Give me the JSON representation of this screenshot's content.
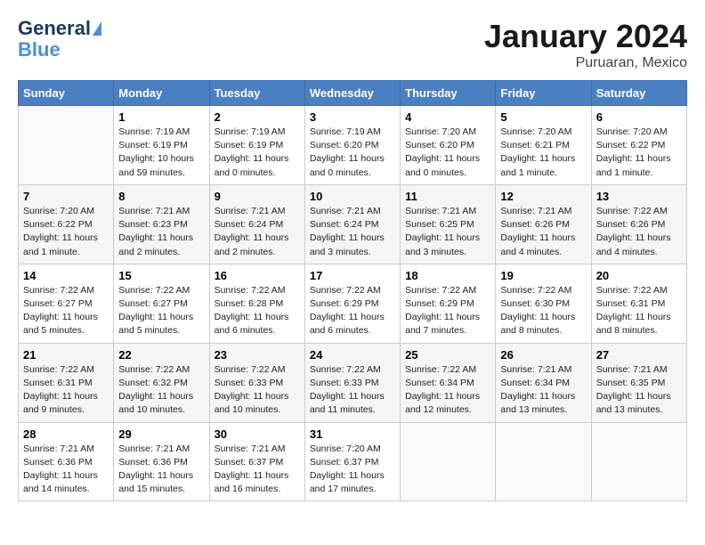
{
  "header": {
    "logo_line1": "General",
    "logo_line2": "Blue",
    "title": "January 2024",
    "subtitle": "Puruaran, Mexico"
  },
  "days_of_week": [
    "Sunday",
    "Monday",
    "Tuesday",
    "Wednesday",
    "Thursday",
    "Friday",
    "Saturday"
  ],
  "weeks": [
    [
      {
        "num": "",
        "info": ""
      },
      {
        "num": "1",
        "info": "Sunrise: 7:19 AM\nSunset: 6:19 PM\nDaylight: 10 hours\nand 59 minutes."
      },
      {
        "num": "2",
        "info": "Sunrise: 7:19 AM\nSunset: 6:19 PM\nDaylight: 11 hours\nand 0 minutes."
      },
      {
        "num": "3",
        "info": "Sunrise: 7:19 AM\nSunset: 6:20 PM\nDaylight: 11 hours\nand 0 minutes."
      },
      {
        "num": "4",
        "info": "Sunrise: 7:20 AM\nSunset: 6:20 PM\nDaylight: 11 hours\nand 0 minutes."
      },
      {
        "num": "5",
        "info": "Sunrise: 7:20 AM\nSunset: 6:21 PM\nDaylight: 11 hours\nand 1 minute."
      },
      {
        "num": "6",
        "info": "Sunrise: 7:20 AM\nSunset: 6:22 PM\nDaylight: 11 hours\nand 1 minute."
      }
    ],
    [
      {
        "num": "7",
        "info": "Sunrise: 7:20 AM\nSunset: 6:22 PM\nDaylight: 11 hours\nand 1 minute."
      },
      {
        "num": "8",
        "info": "Sunrise: 7:21 AM\nSunset: 6:23 PM\nDaylight: 11 hours\nand 2 minutes."
      },
      {
        "num": "9",
        "info": "Sunrise: 7:21 AM\nSunset: 6:24 PM\nDaylight: 11 hours\nand 2 minutes."
      },
      {
        "num": "10",
        "info": "Sunrise: 7:21 AM\nSunset: 6:24 PM\nDaylight: 11 hours\nand 3 minutes."
      },
      {
        "num": "11",
        "info": "Sunrise: 7:21 AM\nSunset: 6:25 PM\nDaylight: 11 hours\nand 3 minutes."
      },
      {
        "num": "12",
        "info": "Sunrise: 7:21 AM\nSunset: 6:26 PM\nDaylight: 11 hours\nand 4 minutes."
      },
      {
        "num": "13",
        "info": "Sunrise: 7:22 AM\nSunset: 6:26 PM\nDaylight: 11 hours\nand 4 minutes."
      }
    ],
    [
      {
        "num": "14",
        "info": "Sunrise: 7:22 AM\nSunset: 6:27 PM\nDaylight: 11 hours\nand 5 minutes."
      },
      {
        "num": "15",
        "info": "Sunrise: 7:22 AM\nSunset: 6:27 PM\nDaylight: 11 hours\nand 5 minutes."
      },
      {
        "num": "16",
        "info": "Sunrise: 7:22 AM\nSunset: 6:28 PM\nDaylight: 11 hours\nand 6 minutes."
      },
      {
        "num": "17",
        "info": "Sunrise: 7:22 AM\nSunset: 6:29 PM\nDaylight: 11 hours\nand 6 minutes."
      },
      {
        "num": "18",
        "info": "Sunrise: 7:22 AM\nSunset: 6:29 PM\nDaylight: 11 hours\nand 7 minutes."
      },
      {
        "num": "19",
        "info": "Sunrise: 7:22 AM\nSunset: 6:30 PM\nDaylight: 11 hours\nand 8 minutes."
      },
      {
        "num": "20",
        "info": "Sunrise: 7:22 AM\nSunset: 6:31 PM\nDaylight: 11 hours\nand 8 minutes."
      }
    ],
    [
      {
        "num": "21",
        "info": "Sunrise: 7:22 AM\nSunset: 6:31 PM\nDaylight: 11 hours\nand 9 minutes."
      },
      {
        "num": "22",
        "info": "Sunrise: 7:22 AM\nSunset: 6:32 PM\nDaylight: 11 hours\nand 10 minutes."
      },
      {
        "num": "23",
        "info": "Sunrise: 7:22 AM\nSunset: 6:33 PM\nDaylight: 11 hours\nand 10 minutes."
      },
      {
        "num": "24",
        "info": "Sunrise: 7:22 AM\nSunset: 6:33 PM\nDaylight: 11 hours\nand 11 minutes."
      },
      {
        "num": "25",
        "info": "Sunrise: 7:22 AM\nSunset: 6:34 PM\nDaylight: 11 hours\nand 12 minutes."
      },
      {
        "num": "26",
        "info": "Sunrise: 7:21 AM\nSunset: 6:34 PM\nDaylight: 11 hours\nand 13 minutes."
      },
      {
        "num": "27",
        "info": "Sunrise: 7:21 AM\nSunset: 6:35 PM\nDaylight: 11 hours\nand 13 minutes."
      }
    ],
    [
      {
        "num": "28",
        "info": "Sunrise: 7:21 AM\nSunset: 6:36 PM\nDaylight: 11 hours\nand 14 minutes."
      },
      {
        "num": "29",
        "info": "Sunrise: 7:21 AM\nSunset: 6:36 PM\nDaylight: 11 hours\nand 15 minutes."
      },
      {
        "num": "30",
        "info": "Sunrise: 7:21 AM\nSunset: 6:37 PM\nDaylight: 11 hours\nand 16 minutes."
      },
      {
        "num": "31",
        "info": "Sunrise: 7:20 AM\nSunset: 6:37 PM\nDaylight: 11 hours\nand 17 minutes."
      },
      {
        "num": "",
        "info": ""
      },
      {
        "num": "",
        "info": ""
      },
      {
        "num": "",
        "info": ""
      }
    ]
  ]
}
